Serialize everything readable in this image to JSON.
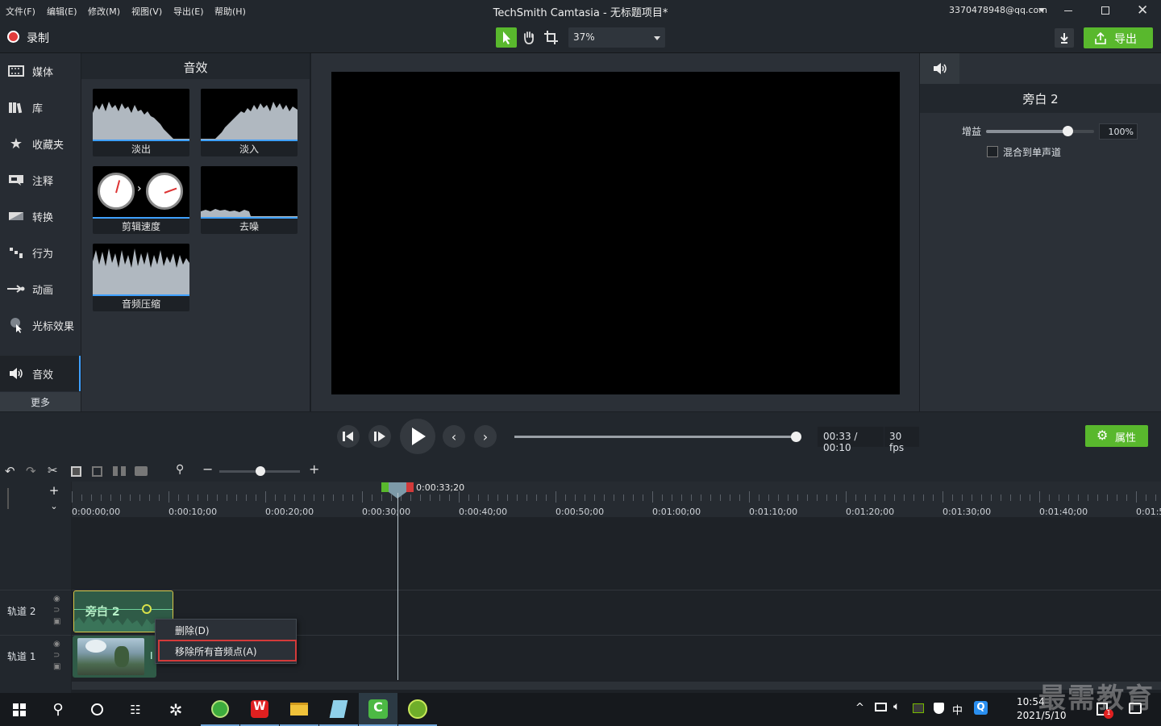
{
  "menubar": {
    "items": [
      "文件(F)",
      "编辑(E)",
      "修改(M)",
      "视图(V)",
      "导出(E)",
      "帮助(H)"
    ],
    "title": "TechSmith Camtasia - 无标题项目*",
    "account": "3370478948@qq.com"
  },
  "toolbar": {
    "record": "录制",
    "zoom": "37%",
    "export": "导出"
  },
  "nav": {
    "items": [
      "媒体",
      "库",
      "收藏夹",
      "注释",
      "转换",
      "行为",
      "动画",
      "光标效果",
      "音效"
    ],
    "more": "更多"
  },
  "effects": {
    "title": "音效",
    "tiles": [
      "淡出",
      "淡入",
      "剪辑速度",
      "去噪",
      "音频压缩"
    ]
  },
  "properties": {
    "clip_name": "旁白 2",
    "gain_label": "增益",
    "gain_value": "100%",
    "gain_level": 0.75,
    "mono_label": "混合到单声道"
  },
  "playback": {
    "time": "00:33 / 00:10",
    "fps": "30 fps",
    "properties_btn": "属性",
    "progress": 0.98
  },
  "timeline": {
    "playhead": "0:00:33;20",
    "ticks": [
      "0:00:00;00",
      "0:00:10;00",
      "0:00:20;00",
      "0:00:30;00",
      "0:00:40;00",
      "0:00:50;00",
      "0:01:00;00",
      "0:01:10;00",
      "0:01:20;00",
      "0:01:30;00",
      "0:01:40;00",
      "0:01:5"
    ],
    "tracks": [
      "轨道 2",
      "轨道 1"
    ],
    "clip_label": "旁白 2"
  },
  "context_menu": {
    "items": [
      "删除(D)",
      "移除所有音频点(A)"
    ]
  },
  "taskbar": {
    "time": "10:54",
    "date": "2021/5/10",
    "ime": "中",
    "badge": "1"
  },
  "watermark": "最需教育",
  "colors": {
    "accent": "#59b82d",
    "highlight": "#d33a3a",
    "bg": "#1b1f24"
  }
}
